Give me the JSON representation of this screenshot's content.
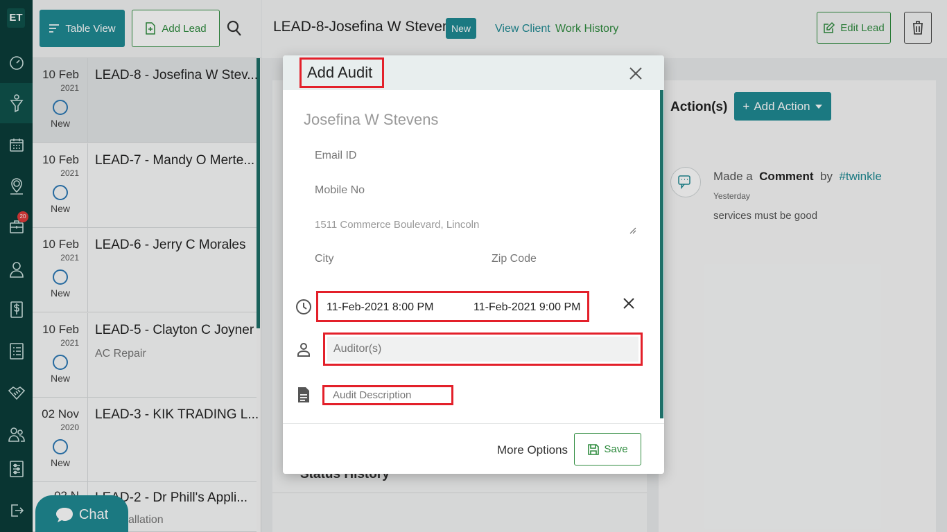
{
  "rail": {
    "logo": "ET",
    "badge_count": "20",
    "items": [
      "dashboard-icon",
      "funnel-icon",
      "calendar-icon",
      "map-pin-icon",
      "briefcase-icon",
      "user-icon",
      "dollar-icon",
      "list-icon",
      "handshake-icon",
      "team-icon",
      "settings-sliders-icon",
      "logout-icon"
    ]
  },
  "toolbar": {
    "table_view_label": "Table View",
    "add_lead_label": "Add Lead"
  },
  "leads": [
    {
      "day": "10 Feb",
      "year": "2021",
      "status": "New",
      "title": "LEAD-8 - Josefina W Stev...",
      "sub": ""
    },
    {
      "day": "10 Feb",
      "year": "2021",
      "status": "New",
      "title": "LEAD-7 - Mandy O Merte...",
      "sub": ""
    },
    {
      "day": "10 Feb",
      "year": "2021",
      "status": "New",
      "title": "LEAD-6 - Jerry C Morales",
      "sub": ""
    },
    {
      "day": "10 Feb",
      "year": "2021",
      "status": "New",
      "title": "LEAD-5 - Clayton C Joyner",
      "sub": "AC Repair"
    },
    {
      "day": "02 Nov",
      "year": "2020",
      "status": "New",
      "title": "LEAD-3 - KIK TRADING L...",
      "sub": ""
    },
    {
      "day": "02 N",
      "year": "",
      "status": "",
      "title": "LEAD-2 - Dr Phill's Appli...",
      "sub": "allation"
    }
  ],
  "chat": {
    "label": "Chat"
  },
  "header": {
    "lead_title": "LEAD-8-Josefina W Stevens",
    "status_badge": "New",
    "view_client": "View Client",
    "work_history": "Work History",
    "edit_lead": "Edit Lead"
  },
  "actions": {
    "title": "Action(s)",
    "add_action": "Add Action",
    "activity": {
      "prefix": "Made a",
      "kind": "Comment",
      "by": "by",
      "user": "#twinkle",
      "time": "Yesterday",
      "text": "services must be good"
    }
  },
  "status_history": {
    "label": "Status History"
  },
  "modal": {
    "title": "Add Audit",
    "client_name": "Josefina W Stevens",
    "email_label": "Email ID",
    "mobile_label": "Mobile No",
    "address": "1511  Commerce Boulevard, Lincoln",
    "city_label": "City",
    "zip_label": "Zip Code",
    "start_time": "11-Feb-2021 8:00 PM",
    "end_time": "11-Feb-2021 9:00 PM",
    "auditor_placeholder": "Auditor(s)",
    "description_placeholder": "Audit Description",
    "more_options": "More Options",
    "save": "Save"
  },
  "colors": {
    "teal": "#1f8a93",
    "green": "#2e8b3e",
    "rail": "#0b3d39",
    "highlight": "#e3202a"
  }
}
